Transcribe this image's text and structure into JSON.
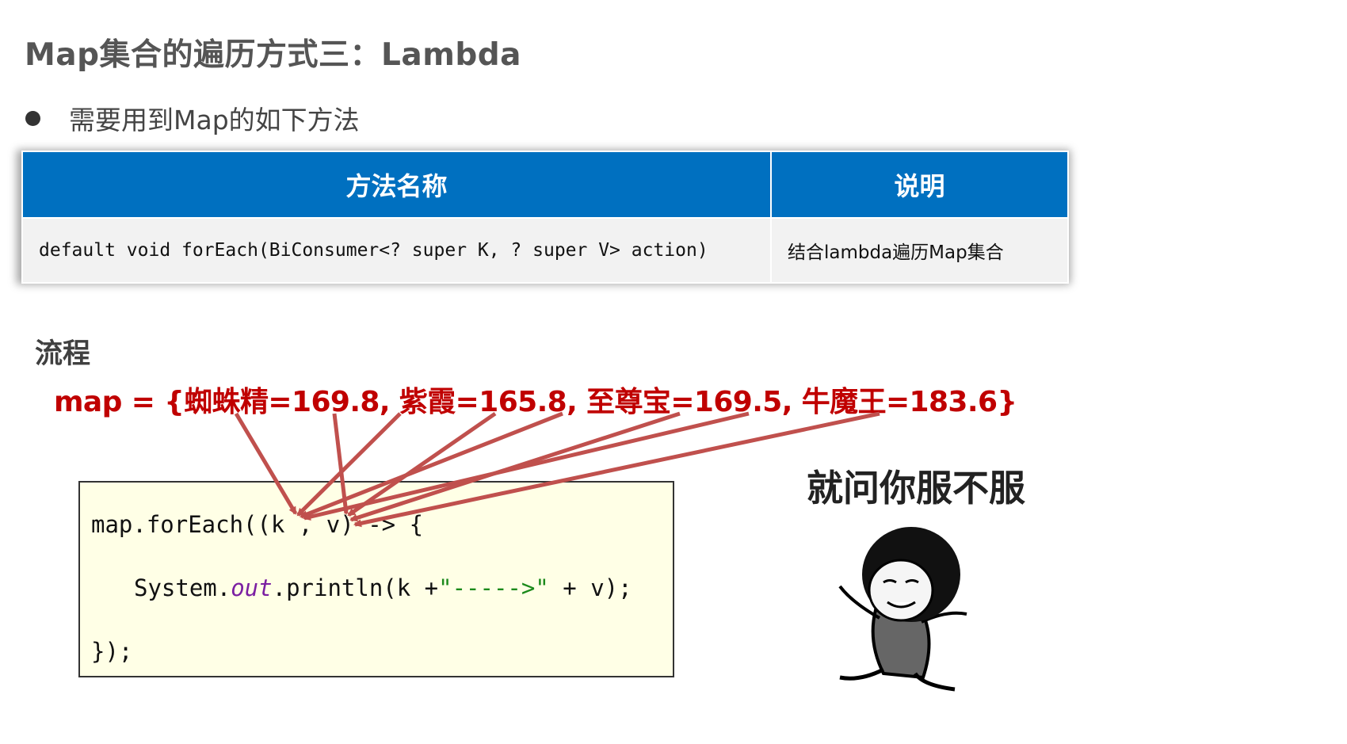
{
  "title": "Map集合的遍历方式三：Lambda",
  "bullet": "需要用到Map的如下方法",
  "table": {
    "headers": [
      "方法名称",
      "说明"
    ],
    "rows": [
      [
        "default void forEach(BiConsumer<? super K, ? super V> action)",
        "结合lambda遍历Map集合"
      ]
    ]
  },
  "flow_label": "流程",
  "map_line": "map = {蜘蛛精=169.8, 紫霞=165.8, 至尊宝=169.5, 牛魔王=183.6}",
  "code": {
    "line1": "map.forEach((k , v) -> {",
    "line2_prefix": "System.",
    "line2_out": "out",
    "line2_mid": ".println(k +",
    "line2_str": "\"----->\"",
    "line2_suffix": " + v);",
    "line3": "});"
  },
  "meme_caption": "就问你服不服",
  "colors": {
    "header_blue": "#0070c0",
    "map_red": "#c00000",
    "arrow": "#c0504d",
    "code_bg": "#ffffe6"
  }
}
